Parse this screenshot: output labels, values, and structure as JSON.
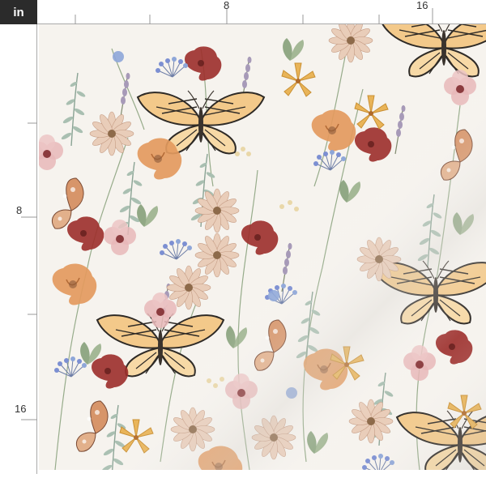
{
  "ruler": {
    "unit": "in",
    "top_labels": [
      "8",
      "16"
    ],
    "left_labels": [
      "8",
      "16"
    ]
  },
  "fabric": {
    "motifs": [
      "butterfly",
      "poppy",
      "daisy",
      "wildflower",
      "fern",
      "lavender"
    ],
    "colors": {
      "background": "#f6f3ee",
      "butterfly_wing": "#f3c98a",
      "poppy_orange": "#e39a5e",
      "poppy_red": "#9c2e2a",
      "pink": "#e8b7b8",
      "blue": "#8ea6d8",
      "leaf": "#7f9a72",
      "dusty_rose": "#d79a83"
    }
  }
}
